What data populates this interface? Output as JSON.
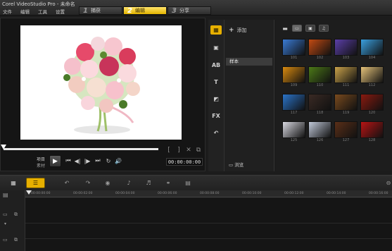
{
  "app": {
    "title": "Corel VideoStudio Pro - 未命名"
  },
  "menu": [
    "文件",
    "编辑",
    "工具",
    "设置"
  ],
  "steps": [
    {
      "num": "1",
      "label": "捕获",
      "active": false
    },
    {
      "num": "2",
      "label": "编辑",
      "active": true
    },
    {
      "num": "3",
      "label": "分享",
      "active": false
    }
  ],
  "player": {
    "project_label": "项目",
    "clip_label": "素材",
    "timecode": "00:00:00:00",
    "controls": [
      "▶",
      "⏮",
      "◀|",
      "|▶",
      "⏭",
      "↻",
      "🔊"
    ],
    "trim": [
      "[",
      "]",
      "✕",
      "⧉"
    ]
  },
  "library": {
    "add_label": "添加",
    "folder": "样本",
    "browse_label": "浏览",
    "thumbs": [
      {
        "id": "101",
        "color": "#3a7bd5"
      },
      {
        "id": "102",
        "color": "#c24a12"
      },
      {
        "id": "103",
        "color": "#5b3fa8"
      },
      {
        "id": "104",
        "color": "#3aa0e0"
      },
      {
        "id": "109",
        "color": "#d88a10"
      },
      {
        "id": "110",
        "color": "#4c7a18"
      },
      {
        "id": "111",
        "color": "#c9a24a"
      },
      {
        "id": "112",
        "color": "#e5c27a"
      },
      {
        "id": "117",
        "color": "#2b74c9"
      },
      {
        "id": "118",
        "color": "#3a2a24"
      },
      {
        "id": "119",
        "color": "#7a4a1e"
      },
      {
        "id": "120",
        "color": "#8a1a10"
      },
      {
        "id": "125",
        "color": "#d8d8e0"
      },
      {
        "id": "126",
        "color": "#c0c8d8"
      },
      {
        "id": "127",
        "color": "#5a2f18"
      },
      {
        "id": "128",
        "color": "#b81414"
      }
    ]
  },
  "timeline": {
    "ticks": [
      "00:00:00:00",
      "00:00:02:00",
      "00:00:04:00",
      "00:00:06:00",
      "00:00:08:00",
      "00:00:10:00",
      "00:00:12:00",
      "00:00:14:00",
      "00:00:16:00"
    ]
  },
  "colors": {
    "accent": "#e7b000",
    "background": "#1c1c1c"
  }
}
